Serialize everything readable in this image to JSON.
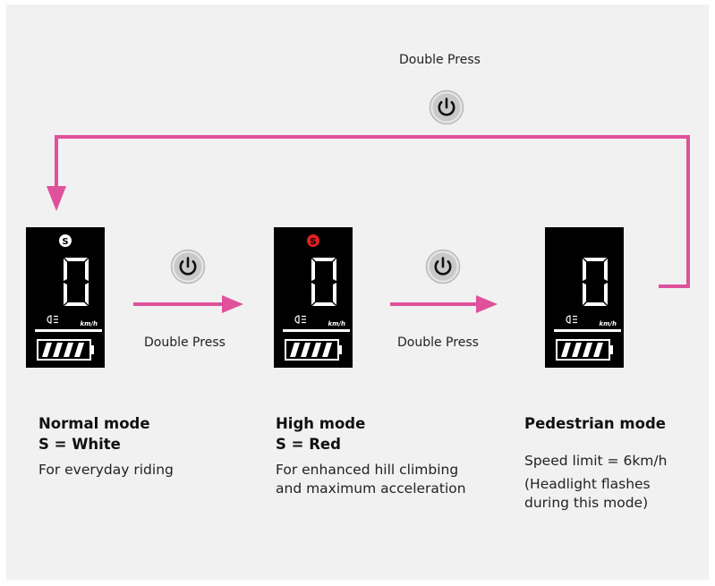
{
  "colors": {
    "accent": "#e0519b",
    "background": "#f1f1f1",
    "display": "#000000",
    "s_white": "#ffffff",
    "s_red": "#e02020"
  },
  "icons": {
    "button": "power-icon",
    "light": "headlight-icon",
    "battery": "battery-icon"
  },
  "transitions": [
    {
      "label": "Double Press"
    },
    {
      "label": "Double Press"
    },
    {
      "label": "Double Press"
    }
  ],
  "displays": [
    {
      "s_glyph": "S",
      "digit": "0",
      "unit": "km/h"
    },
    {
      "s_glyph": "S",
      "digit": "0",
      "unit": "km/h"
    },
    {
      "digit": "0",
      "unit": "km/h"
    }
  ],
  "modes": [
    {
      "title": "Normal mode",
      "subtitle": "S = White",
      "lines": [
        "For everyday riding"
      ]
    },
    {
      "title": "High mode",
      "subtitle": "S = Red",
      "lines": [
        "For enhanced hill climbing and maximum acceleration"
      ]
    },
    {
      "title": "Pedestrian mode",
      "lines": [
        "Speed limit = 6km/h",
        "(Headlight flashes during this mode)"
      ]
    }
  ]
}
